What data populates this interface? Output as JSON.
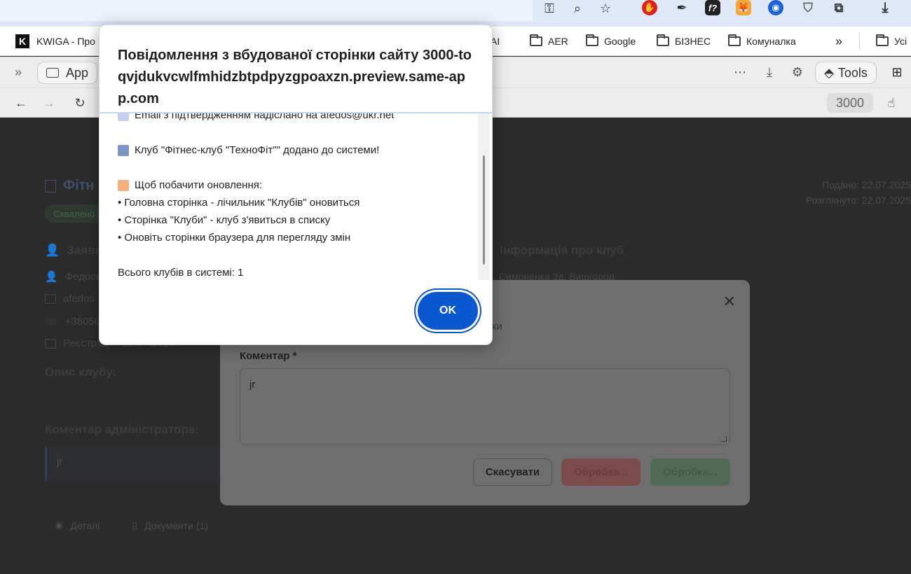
{
  "browser": {
    "bookmarks": [
      {
        "label": "KWIGA - Про"
      },
      {
        "label": "AI"
      },
      {
        "label": "AER"
      },
      {
        "label": "Google"
      },
      {
        "label": "БІЗНЕС"
      },
      {
        "label": "Комуналка"
      },
      {
        "label": "Усі"
      }
    ],
    "more_bookmarks": "»",
    "app_tab": "App",
    "tools_label": "Tools",
    "port": "3000"
  },
  "page": {
    "title": "Фітн",
    "badge": "Схвалено",
    "submitted": "Подано: 22.07.2025",
    "reviewed": "Розглянуто: 22.07.2025",
    "applicant_heading": "Заявн",
    "club_info_heading": "Інформація про клуб",
    "club_address": "Симоненка 3д, Вишгород",
    "applicant_name": "Федосє",
    "applicant_email": "afedos",
    "applicant_phone": "+38050",
    "applicant_registered": "Реєстрація: 22.07.2025",
    "club_description_heading": "Опис клубу:",
    "admin_comment_heading": "Коментар адміністратора:",
    "admin_comment": "jr",
    "tabs": [
      {
        "label": "Деталі"
      },
      {
        "label": "Документи (1)"
      }
    ]
  },
  "inner_modal": {
    "subtitle": "вки",
    "comment_label": "Коментар *",
    "comment_value": "jr",
    "cancel_label": "Скасувати",
    "reject_label": "Обробка...",
    "approve_label": "Обробка..."
  },
  "alert": {
    "title": "Повідомлення з вбудованої сторінки сайту 3000-toqvjdukvcwlfmhidzbtpdpyzgpoaxzn.preview.same-app.com",
    "lines": [
      "Email з підтвердженням надіслано на afedos@ukr.net",
      "Клуб \"Фітнес-клуб \"ТехноФіт\"\" додано до системи!",
      "Щоб побачити оновлення:",
      "• Головна сторінка - лічильник \"Клубів\" оновиться",
      "• Сторінка \"Клуби\" - клуб з'явиться в списку",
      "• Оновіть сторінки браузера для перегляду змін",
      "Всього клубів в системі: 1"
    ],
    "ok_label": "OK"
  },
  "colors": {
    "accent": "#0b57d0",
    "page_background": "#2b2b2b",
    "topbar": "#dfe8f6"
  }
}
